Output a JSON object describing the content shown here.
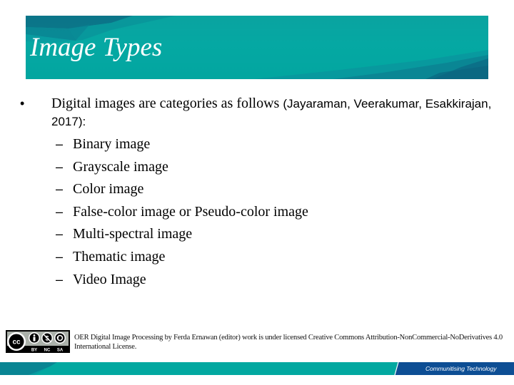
{
  "slide": {
    "title": "Image Types",
    "bullet": {
      "symbol": "•",
      "text_main": "Digital images are categories as follows ",
      "text_citation": "(Jayaraman, Veerakumar, Esakkirajan, 2017):"
    },
    "sub_items": [
      {
        "dash": "–",
        "label": "Binary image"
      },
      {
        "dash": "–",
        "label": "Grayscale image"
      },
      {
        "dash": "–",
        "label": "Color image"
      },
      {
        "dash": "–",
        "label": "False-color image or Pseudo-color image"
      },
      {
        "dash": "–",
        "label": "Multi-spectral image"
      },
      {
        "dash": "–",
        "label": "Thematic image"
      },
      {
        "dash": "–",
        "label": "Video Image"
      }
    ]
  },
  "license": {
    "badge": {
      "icons": [
        "cc-icon",
        "attribution-icon",
        "noncommercial-icon",
        "no-derivatives-icon"
      ],
      "labels": [
        "BY",
        "NC",
        "SA"
      ]
    },
    "text": "OER Digital Image Processing by Ferda Ernawan (editor) work is under licensed Creative Commons Attribution-NonCommercial-NoDerivatives 4.0 International License."
  },
  "footer": {
    "tagline": "Communitising Technology",
    "colors": {
      "teal": "#02a8a0",
      "blue": "#0d4e94"
    }
  },
  "theme": {
    "header_teal": "#05a8a3",
    "header_dark": "#0b6f86"
  }
}
